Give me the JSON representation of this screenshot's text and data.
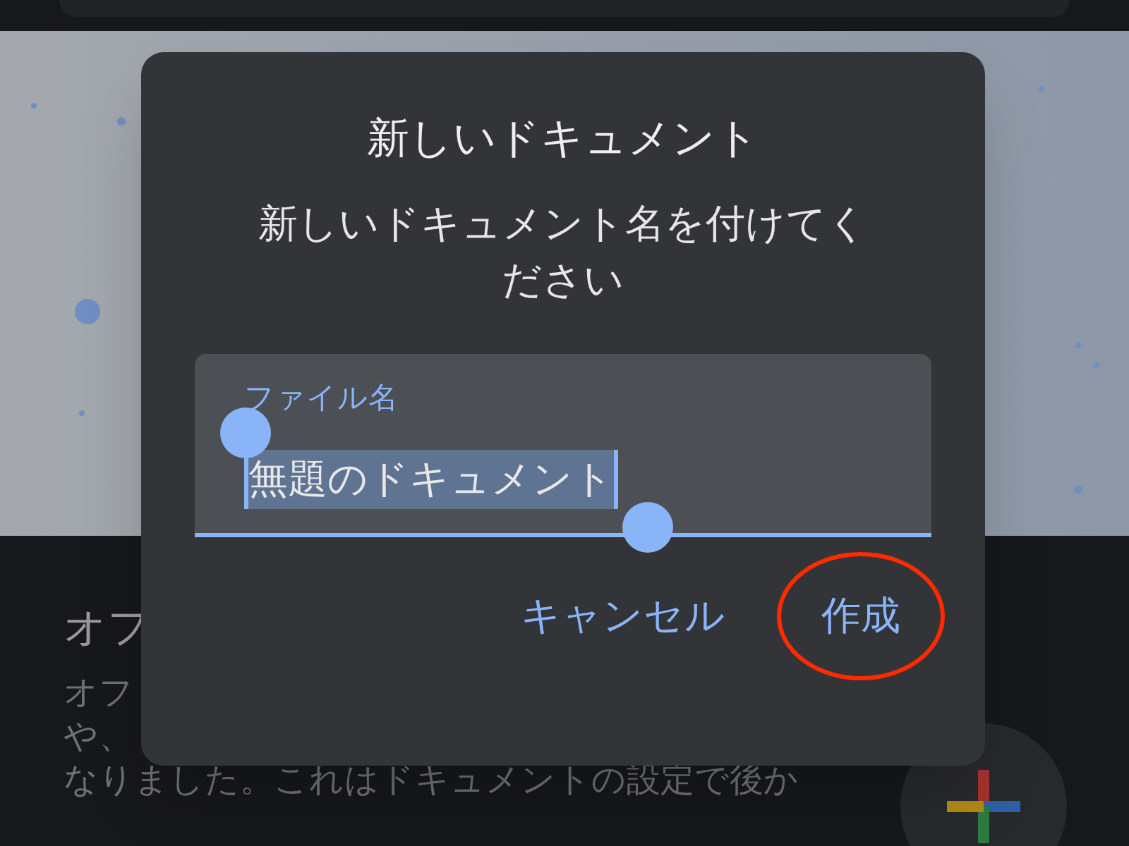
{
  "background": {
    "heading": "オフ",
    "paragraph_lines": [
      "オフ",
      "や、",
      "なりました。これはドキュメントの設定で後か"
    ]
  },
  "dialog": {
    "title": "新しいドキュメント",
    "message": "新しいドキュメント名を付けてください",
    "field": {
      "label": "ファイル名",
      "value": "無題のドキュメント",
      "text_selected": true
    },
    "buttons": [
      {
        "label": "キャンセル",
        "circled": false
      },
      {
        "label": "作成",
        "circled": true
      }
    ]
  }
}
